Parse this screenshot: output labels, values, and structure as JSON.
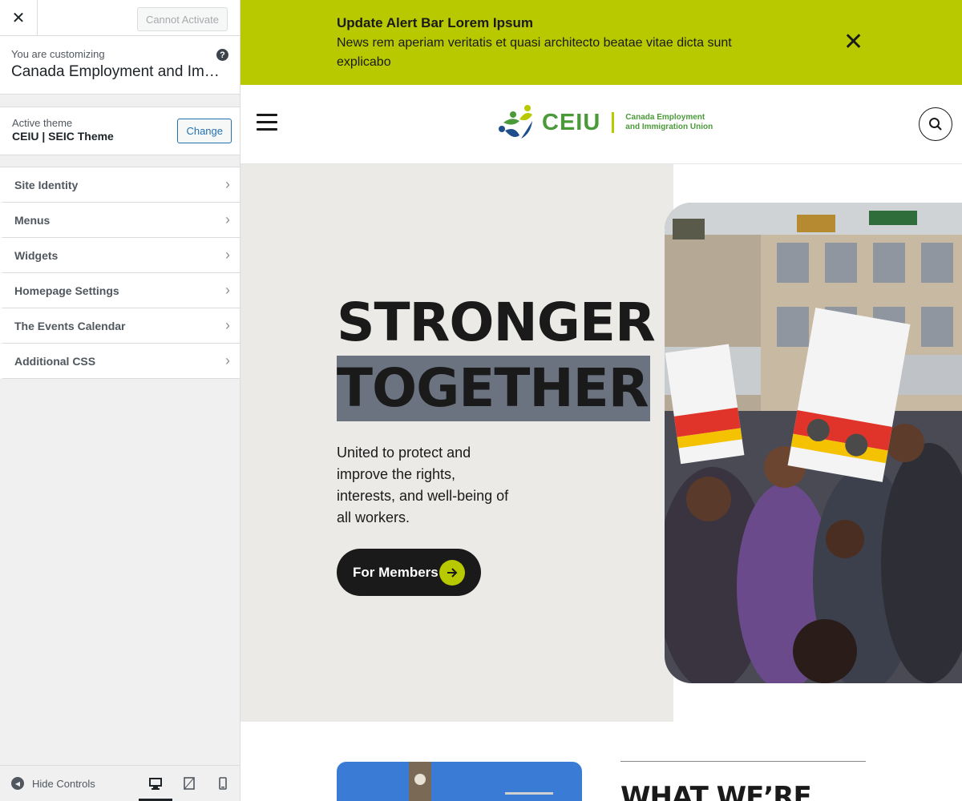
{
  "customizer": {
    "close_icon": "close-icon",
    "activate_label": "Cannot Activate",
    "customizing_label": "You are customizing",
    "site_name": "Canada Employment and Immigration Union",
    "help_icon": "help-icon",
    "active_theme_label": "Active theme",
    "theme_name": "CEIU | SEIC Theme",
    "change_label": "Change",
    "sections": [
      {
        "label": "Site Identity"
      },
      {
        "label": "Menus"
      },
      {
        "label": "Widgets"
      },
      {
        "label": "Homepage Settings"
      },
      {
        "label": "The Events Calendar"
      },
      {
        "label": "Additional CSS"
      }
    ],
    "hide_controls_label": "Hide Controls",
    "devices": [
      "desktop",
      "tablet",
      "mobile"
    ],
    "active_device": "desktop"
  },
  "alert": {
    "title": "Update Alert Bar Lorem Ipsum",
    "text": "News rem aperiam veritatis et quasi architecto beatae vitae dicta sunt explicabo",
    "color": "#b8c900"
  },
  "header": {
    "logo_text": "CEIU",
    "logo_sub_1": "Canada Employment",
    "logo_sub_2": "and Immigration Union"
  },
  "hero": {
    "title_line_1": "STRONGER",
    "title_line_2": "TOGETHER",
    "text": "United to protect and improve the rights, interests, and well-being of all workers.",
    "button_label": "For Members",
    "image_alt": "Union members rallying on a city street with PSAC AFPC signs"
  },
  "next_section": {
    "title": "WHAT WE’RE"
  }
}
